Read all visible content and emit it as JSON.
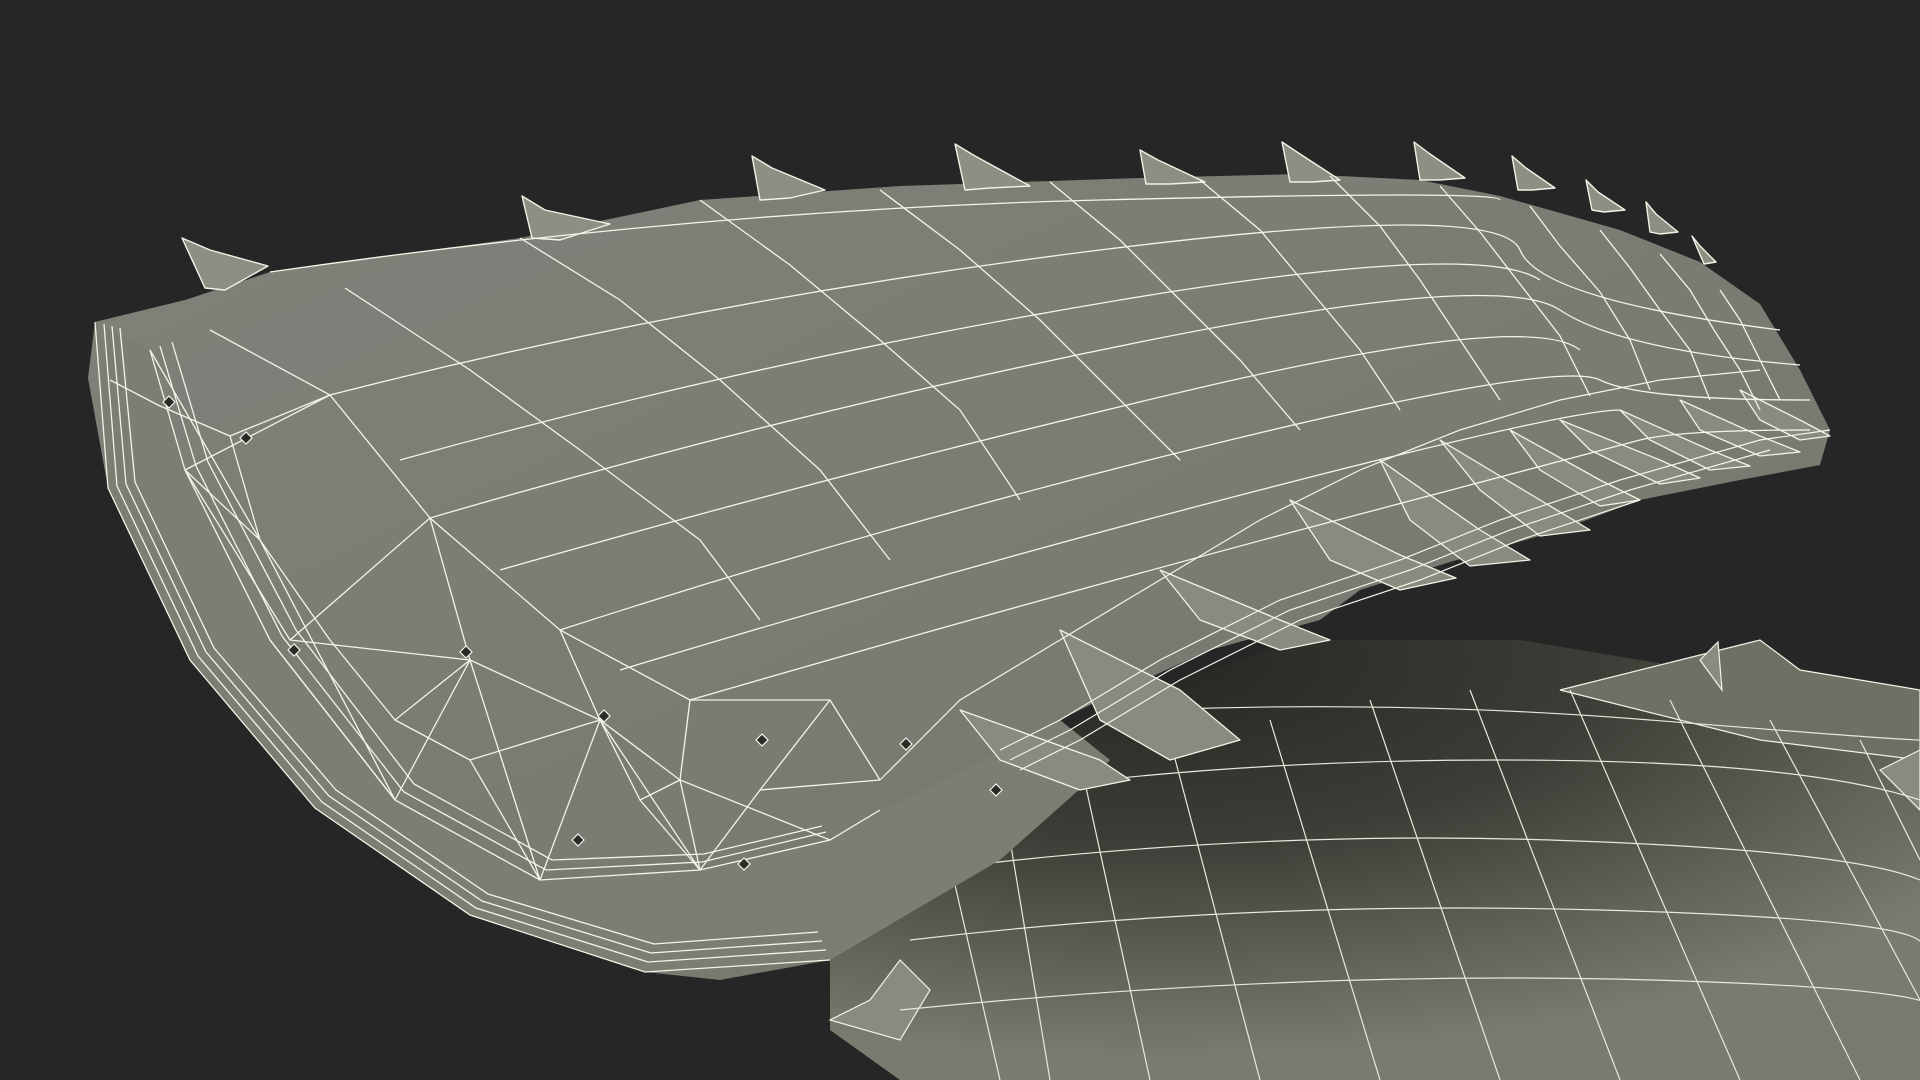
{
  "scene": {
    "background_color": "#262626",
    "mesh_fill_color": "#7b7c70",
    "mesh_dark_color": "#2f302b",
    "wire_color": "#f2f2e6",
    "render_mode": "wireframe-over-shaded",
    "subject": "3d-mesh-spiny-plate"
  }
}
